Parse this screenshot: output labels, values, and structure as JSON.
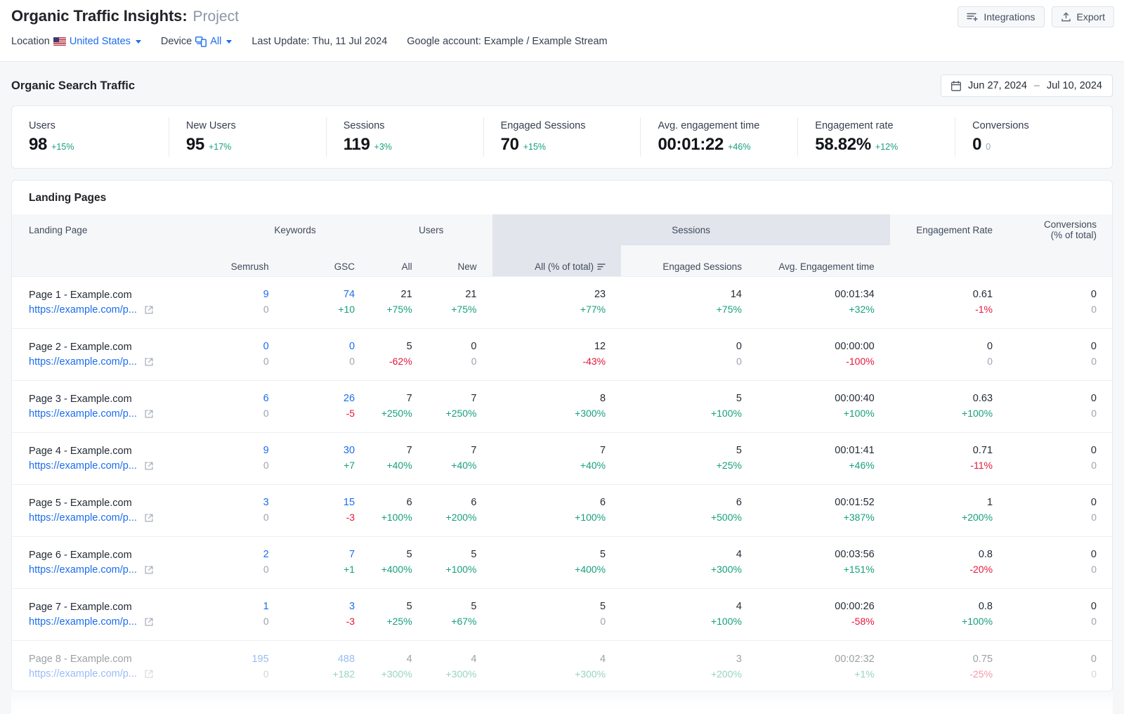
{
  "header": {
    "title_main": "Organic Traffic Insights:",
    "title_project": "Project",
    "location_label": "Location",
    "location_value": "United States",
    "device_label": "Device",
    "device_value": "All",
    "last_update": "Last Update: Thu, 11 Jul 2024",
    "google_account": "Google account: Example / Example Stream",
    "integrations_button": "Integrations",
    "export_button": "Export"
  },
  "section": {
    "title": "Organic Search Traffic",
    "date_start": "Jun 27, 2024",
    "date_dash": "–",
    "date_end": "Jul 10, 2024"
  },
  "kpis": [
    {
      "label": "Users",
      "value": "98",
      "delta": "+15%",
      "dir": "pos"
    },
    {
      "label": "New Users",
      "value": "95",
      "delta": "+17%",
      "dir": "pos"
    },
    {
      "label": "Sessions",
      "value": "119",
      "delta": "+3%",
      "dir": "pos"
    },
    {
      "label": "Engaged Sessions",
      "value": "70",
      "delta": "+15%",
      "dir": "pos"
    },
    {
      "label": "Avg. engagement time",
      "value": "00:01:22",
      "delta": "+46%",
      "dir": "pos"
    },
    {
      "label": "Engagement rate",
      "value": "58.82%",
      "delta": "+12%",
      "dir": "pos"
    },
    {
      "label": "Conversions",
      "value": "0",
      "delta": "0",
      "dir": "zero"
    }
  ],
  "table": {
    "title": "Landing Pages",
    "groups": {
      "landing_page": "Landing Page",
      "keywords": "Keywords",
      "users": "Users",
      "sessions": "Sessions",
      "engagement_rate": "Engagement Rate",
      "conversions": "Conversions",
      "conversions_sub": "(% of total)"
    },
    "subheads": {
      "semrush": "Semrush",
      "gsc": "GSC",
      "users_all": "All",
      "users_new": "New",
      "sessions_all": "All (% of total)",
      "engaged_sessions": "Engaged Sessions",
      "avg_engagement_time": "Avg. Engagement time"
    },
    "rows": [
      {
        "name": "Page 1 - Example.com",
        "url": "https://example.com/p...",
        "semrush": {
          "v": "9",
          "d": "0",
          "vc": "blue",
          "dc": "grey"
        },
        "gsc": {
          "v": "74",
          "d": "+10",
          "vc": "blue",
          "dc": "pos"
        },
        "users_all": {
          "v": "21",
          "d": "+75%",
          "vc": "dark",
          "dc": "pos"
        },
        "users_new": {
          "v": "21",
          "d": "+75%",
          "vc": "dark",
          "dc": "pos"
        },
        "sessions_all": {
          "v": "23",
          "d": "+77%",
          "vc": "dark",
          "dc": "pos"
        },
        "engaged": {
          "v": "14",
          "d": "+75%",
          "vc": "dark",
          "dc": "pos"
        },
        "avg_time": {
          "v": "00:01:34",
          "d": "+32%",
          "vc": "dark",
          "dc": "pos"
        },
        "eng_rate": {
          "v": "0.61",
          "d": "-1%",
          "vc": "dark",
          "dc": "neg"
        },
        "conversions": {
          "v": "0",
          "d": "0",
          "vc": "dark",
          "dc": "grey"
        }
      },
      {
        "name": "Page 2 - Example.com",
        "url": "https://example.com/p...",
        "semrush": {
          "v": "0",
          "d": "0",
          "vc": "blue",
          "dc": "grey"
        },
        "gsc": {
          "v": "0",
          "d": "0",
          "vc": "blue",
          "dc": "grey"
        },
        "users_all": {
          "v": "5",
          "d": "-62%",
          "vc": "dark",
          "dc": "neg"
        },
        "users_new": {
          "v": "0",
          "d": "0",
          "vc": "dark",
          "dc": "grey"
        },
        "sessions_all": {
          "v": "12",
          "d": "-43%",
          "vc": "dark",
          "dc": "neg"
        },
        "engaged": {
          "v": "0",
          "d": "0",
          "vc": "dark",
          "dc": "grey"
        },
        "avg_time": {
          "v": "00:00:00",
          "d": "-100%",
          "vc": "dark",
          "dc": "neg"
        },
        "eng_rate": {
          "v": "0",
          "d": "0",
          "vc": "dark",
          "dc": "grey"
        },
        "conversions": {
          "v": "0",
          "d": "0",
          "vc": "dark",
          "dc": "grey"
        }
      },
      {
        "name": "Page 3 - Example.com",
        "url": "https://example.com/p...",
        "semrush": {
          "v": "6",
          "d": "0",
          "vc": "blue",
          "dc": "grey"
        },
        "gsc": {
          "v": "26",
          "d": "-5",
          "vc": "blue",
          "dc": "neg"
        },
        "users_all": {
          "v": "7",
          "d": "+250%",
          "vc": "dark",
          "dc": "pos"
        },
        "users_new": {
          "v": "7",
          "d": "+250%",
          "vc": "dark",
          "dc": "pos"
        },
        "sessions_all": {
          "v": "8",
          "d": "+300%",
          "vc": "dark",
          "dc": "pos"
        },
        "engaged": {
          "v": "5",
          "d": "+100%",
          "vc": "dark",
          "dc": "pos"
        },
        "avg_time": {
          "v": "00:00:40",
          "d": "+100%",
          "vc": "dark",
          "dc": "pos"
        },
        "eng_rate": {
          "v": "0.63",
          "d": "+100%",
          "vc": "dark",
          "dc": "pos"
        },
        "conversions": {
          "v": "0",
          "d": "0",
          "vc": "dark",
          "dc": "grey"
        }
      },
      {
        "name": "Page 4 - Example.com",
        "url": "https://example.com/p...",
        "semrush": {
          "v": "9",
          "d": "0",
          "vc": "blue",
          "dc": "grey"
        },
        "gsc": {
          "v": "30",
          "d": "+7",
          "vc": "blue",
          "dc": "pos"
        },
        "users_all": {
          "v": "7",
          "d": "+40%",
          "vc": "dark",
          "dc": "pos"
        },
        "users_new": {
          "v": "7",
          "d": "+40%",
          "vc": "dark",
          "dc": "pos"
        },
        "sessions_all": {
          "v": "7",
          "d": "+40%",
          "vc": "dark",
          "dc": "pos"
        },
        "engaged": {
          "v": "5",
          "d": "+25%",
          "vc": "dark",
          "dc": "pos"
        },
        "avg_time": {
          "v": "00:01:41",
          "d": "+46%",
          "vc": "dark",
          "dc": "pos"
        },
        "eng_rate": {
          "v": "0.71",
          "d": "-11%",
          "vc": "dark",
          "dc": "neg"
        },
        "conversions": {
          "v": "0",
          "d": "0",
          "vc": "dark",
          "dc": "grey"
        }
      },
      {
        "name": "Page 5 - Example.com",
        "url": "https://example.com/p...",
        "semrush": {
          "v": "3",
          "d": "0",
          "vc": "blue",
          "dc": "grey"
        },
        "gsc": {
          "v": "15",
          "d": "-3",
          "vc": "blue",
          "dc": "neg"
        },
        "users_all": {
          "v": "6",
          "d": "+100%",
          "vc": "dark",
          "dc": "pos"
        },
        "users_new": {
          "v": "6",
          "d": "+200%",
          "vc": "dark",
          "dc": "pos"
        },
        "sessions_all": {
          "v": "6",
          "d": "+100%",
          "vc": "dark",
          "dc": "pos"
        },
        "engaged": {
          "v": "6",
          "d": "+500%",
          "vc": "dark",
          "dc": "pos"
        },
        "avg_time": {
          "v": "00:01:52",
          "d": "+387%",
          "vc": "dark",
          "dc": "pos"
        },
        "eng_rate": {
          "v": "1",
          "d": "+200%",
          "vc": "dark",
          "dc": "pos"
        },
        "conversions": {
          "v": "0",
          "d": "0",
          "vc": "dark",
          "dc": "grey"
        }
      },
      {
        "name": "Page 6 - Example.com",
        "url": "https://example.com/p...",
        "semrush": {
          "v": "2",
          "d": "0",
          "vc": "blue",
          "dc": "grey"
        },
        "gsc": {
          "v": "7",
          "d": "+1",
          "vc": "blue",
          "dc": "pos"
        },
        "users_all": {
          "v": "5",
          "d": "+400%",
          "vc": "dark",
          "dc": "pos"
        },
        "users_new": {
          "v": "5",
          "d": "+100%",
          "vc": "dark",
          "dc": "pos"
        },
        "sessions_all": {
          "v": "5",
          "d": "+400%",
          "vc": "dark",
          "dc": "pos"
        },
        "engaged": {
          "v": "4",
          "d": "+300%",
          "vc": "dark",
          "dc": "pos"
        },
        "avg_time": {
          "v": "00:03:56",
          "d": "+151%",
          "vc": "dark",
          "dc": "pos"
        },
        "eng_rate": {
          "v": "0.8",
          "d": "-20%",
          "vc": "dark",
          "dc": "neg"
        },
        "conversions": {
          "v": "0",
          "d": "0",
          "vc": "dark",
          "dc": "grey"
        }
      },
      {
        "name": "Page 7 - Example.com",
        "url": "https://example.com/p...",
        "semrush": {
          "v": "1",
          "d": "0",
          "vc": "blue",
          "dc": "grey"
        },
        "gsc": {
          "v": "3",
          "d": "-3",
          "vc": "blue",
          "dc": "neg"
        },
        "users_all": {
          "v": "5",
          "d": "+25%",
          "vc": "dark",
          "dc": "pos"
        },
        "users_new": {
          "v": "5",
          "d": "+67%",
          "vc": "dark",
          "dc": "pos"
        },
        "sessions_all": {
          "v": "5",
          "d": "0",
          "vc": "dark",
          "dc": "grey"
        },
        "engaged": {
          "v": "4",
          "d": "+100%",
          "vc": "dark",
          "dc": "pos"
        },
        "avg_time": {
          "v": "00:00:26",
          "d": "-58%",
          "vc": "dark",
          "dc": "neg"
        },
        "eng_rate": {
          "v": "0.8",
          "d": "+100%",
          "vc": "dark",
          "dc": "pos"
        },
        "conversions": {
          "v": "0",
          "d": "0",
          "vc": "dark",
          "dc": "grey"
        }
      },
      {
        "name": "Page 8 - Example.com",
        "url": "https://example.com/p...",
        "semrush": {
          "v": "195",
          "d": "0",
          "vc": "blue",
          "dc": "grey"
        },
        "gsc": {
          "v": "488",
          "d": "+182",
          "vc": "blue",
          "dc": "pos"
        },
        "users_all": {
          "v": "4",
          "d": "+300%",
          "vc": "dark",
          "dc": "pos"
        },
        "users_new": {
          "v": "4",
          "d": "+300%",
          "vc": "dark",
          "dc": "pos"
        },
        "sessions_all": {
          "v": "4",
          "d": "+300%",
          "vc": "dark",
          "dc": "pos"
        },
        "engaged": {
          "v": "3",
          "d": "+200%",
          "vc": "dark",
          "dc": "pos"
        },
        "avg_time": {
          "v": "00:02:32",
          "d": "+1%",
          "vc": "dark",
          "dc": "pos"
        },
        "eng_rate": {
          "v": "0.75",
          "d": "-25%",
          "vc": "dark",
          "dc": "neg"
        },
        "conversions": {
          "v": "0",
          "d": "0",
          "vc": "dark",
          "dc": "grey"
        }
      }
    ]
  }
}
